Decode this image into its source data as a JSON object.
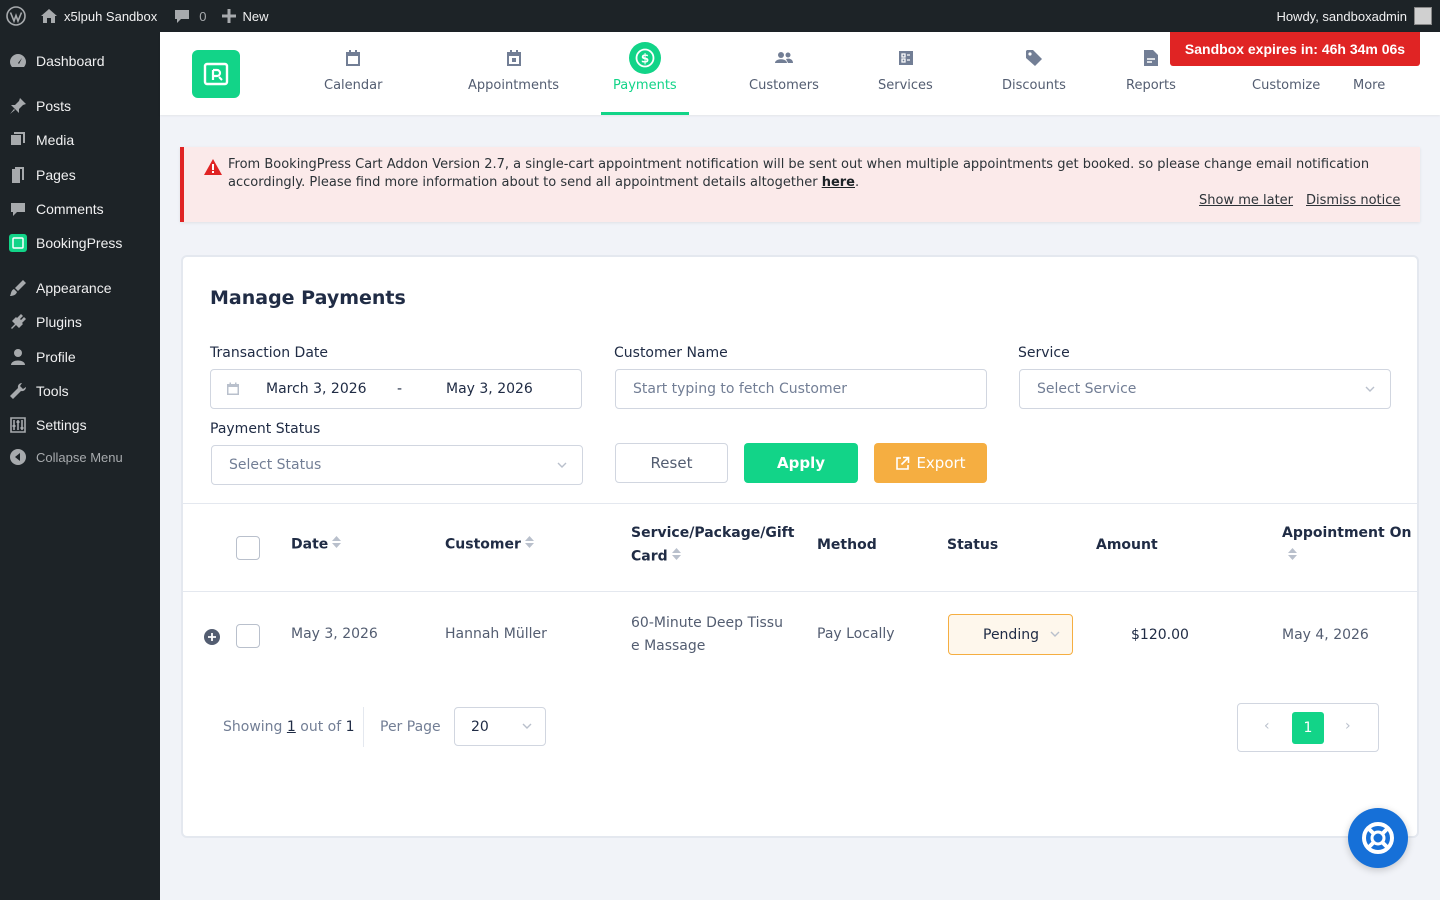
{
  "adminbar": {
    "site_name": "x5lpuh Sandbox",
    "comments_count": "0",
    "new_label": "New",
    "howdy": "Howdy, sandboxadmin"
  },
  "sidebar": {
    "items": [
      {
        "label": "Dashboard",
        "icon": "dashboard-icon"
      },
      {
        "label": "Posts",
        "icon": "pin-icon"
      },
      {
        "label": "Media",
        "icon": "media-icon"
      },
      {
        "label": "Pages",
        "icon": "pages-icon"
      },
      {
        "label": "Comments",
        "icon": "comments-icon"
      },
      {
        "label": "BookingPress",
        "icon": "bookingpress-icon"
      },
      {
        "label": "Appearance",
        "icon": "brush-icon"
      },
      {
        "label": "Plugins",
        "icon": "plugin-icon"
      },
      {
        "label": "Profile",
        "icon": "user-icon"
      },
      {
        "label": "Tools",
        "icon": "wrench-icon"
      },
      {
        "label": "Settings",
        "icon": "sliders-icon"
      }
    ],
    "collapse_label": "Collapse Menu"
  },
  "topnav": {
    "tabs": [
      {
        "label": "Calendar",
        "icon": "calendar-icon"
      },
      {
        "label": "Appointments",
        "icon": "appointments-icon"
      },
      {
        "label": "Payments",
        "icon": "dollar-icon"
      },
      {
        "label": "Customers",
        "icon": "customers-icon"
      },
      {
        "label": "Services",
        "icon": "services-icon"
      },
      {
        "label": "Discounts",
        "icon": "tag-icon"
      },
      {
        "label": "Reports",
        "icon": "report-icon"
      },
      {
        "label": "Customize",
        "icon": "customize-icon"
      },
      {
        "label": "More",
        "icon": "more-icon"
      }
    ],
    "active_tab": "Payments",
    "accent_color": "#12d488"
  },
  "sandbox_banner": "Sandbox expires in: 46h 34m 06s",
  "notice": {
    "text": "From BookingPress Cart Addon Version 2.7, a single-cart appointment notification will be sent out when multiple appointments get booked. so please change email notification accordingly. Please find more information about to send all appointment details altogether ",
    "link_text": "here",
    "text_end": ".",
    "show_later": "Show me later",
    "dismiss": "Dismiss notice"
  },
  "filters": {
    "title": "Manage Payments",
    "transaction_date_label": "Transaction Date",
    "date_start": "March 3, 2026",
    "date_separator": "-",
    "date_end": "May 3, 2026",
    "customer_label": "Customer Name",
    "customer_placeholder": "Start typing to fetch Customer",
    "service_label": "Service",
    "service_placeholder": "Select Service",
    "status_label": "Payment Status",
    "status_placeholder": "Select Status",
    "reset": "Reset",
    "apply": "Apply",
    "export": "Export"
  },
  "table": {
    "columns": [
      "Date",
      "Customer",
      "Service/Package/Gift",
      "Card",
      "Method",
      "Status",
      "Amount",
      "Appointment On"
    ],
    "rows": [
      {
        "date": "May 3, 2026",
        "customer": "Hannah Müller",
        "service_line1": "60-Minute Deep Tissu",
        "service_line2": "e Massage",
        "method": "Pay Locally",
        "status": "Pending",
        "amount": "$120.00",
        "appointment_on": "May 4, 2026"
      }
    ]
  },
  "pagination": {
    "showing_prefix": "Showing",
    "current": "1",
    "out_of": "out of",
    "total": "1",
    "per_page_label": "Per Page",
    "per_page": "20",
    "page": "1",
    "prev": "‹",
    "next": "›"
  }
}
